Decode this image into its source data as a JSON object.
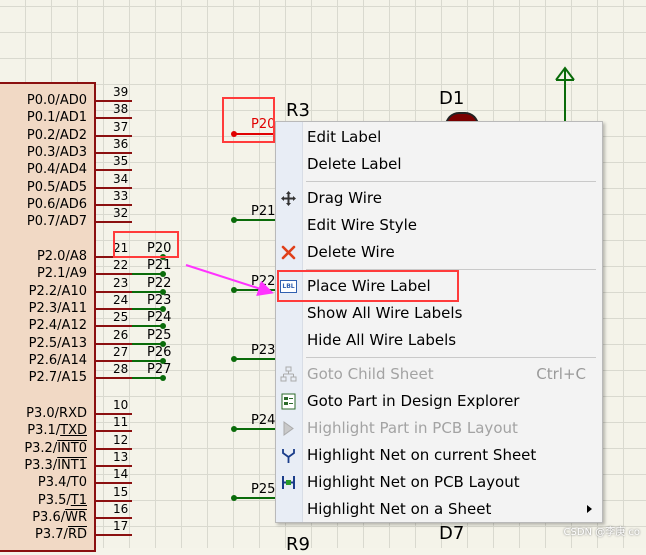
{
  "chip": {
    "left_pins": [
      {
        "label": "P0.0/AD0",
        "num": "39"
      },
      {
        "label": "P0.1/AD1",
        "num": "38"
      },
      {
        "label": "P0.2/AD2",
        "num": "37"
      },
      {
        "label": "P0.3/AD3",
        "num": "36"
      },
      {
        "label": "P0.4/AD4",
        "num": "35"
      },
      {
        "label": "P0.5/AD5",
        "num": "34"
      },
      {
        "label": "P0.6/AD6",
        "num": "33"
      },
      {
        "label": "P0.7/AD7",
        "num": "32"
      },
      {
        "label": "P2.0/A8",
        "num": "21"
      },
      {
        "label": "P2.1/A9",
        "num": "22"
      },
      {
        "label": "P2.2/A10",
        "num": "23"
      },
      {
        "label": "P2.3/A11",
        "num": "24"
      },
      {
        "label": "P2.4/A12",
        "num": "25"
      },
      {
        "label": "P2.5/A13",
        "num": "26"
      },
      {
        "label": "P2.6/A14",
        "num": "27"
      },
      {
        "label": "P2.7/A15",
        "num": "28"
      },
      {
        "label": "P3.0/RXD",
        "num": "10"
      },
      {
        "label": "P3.1/TXD",
        "num": "11"
      },
      {
        "label": "P3.2/INT0",
        "num": "12"
      },
      {
        "label": "P3.3/INT1",
        "num": "13"
      },
      {
        "label": "P3.4/T0",
        "num": "14"
      },
      {
        "label": "P3.5/T1",
        "num": "15"
      },
      {
        "label": "P3.6/WR",
        "num": "16"
      },
      {
        "label": "P3.7/RD",
        "num": "17"
      }
    ],
    "wire_labels": [
      "P20",
      "P21",
      "P22",
      "P23",
      "P24",
      "P25",
      "P26",
      "P27"
    ]
  },
  "schematic": {
    "net_labels": {
      "p20": "P20",
      "p21": "P21",
      "p22": "P22",
      "p23": "P23",
      "p24": "P24",
      "p25": "P25"
    },
    "components": {
      "r3": "R3",
      "d1": "D1",
      "d7": "D7",
      "r9": "R9"
    }
  },
  "context_menu": {
    "items": [
      {
        "label": "Edit Label",
        "icon": "none",
        "enabled": true
      },
      {
        "label": "Delete Label",
        "icon": "none",
        "enabled": true
      },
      {
        "label": "Drag Wire",
        "icon": "move-icon",
        "enabled": true
      },
      {
        "label": "Edit Wire Style",
        "icon": "none",
        "enabled": true
      },
      {
        "label": "Delete Wire",
        "icon": "delete-icon",
        "enabled": true
      },
      {
        "label": "Place Wire Label",
        "icon": "label-icon",
        "icon_text": "LBL",
        "enabled": true
      },
      {
        "label": "Show All Wire Labels",
        "icon": "none",
        "enabled": true
      },
      {
        "label": "Hide All Wire Labels",
        "icon": "none",
        "enabled": true
      },
      {
        "label": "Goto Child Sheet",
        "icon": "hierarchy-icon",
        "enabled": false,
        "shortcut": "Ctrl+C"
      },
      {
        "label": "Goto Part in Design Explorer",
        "icon": "explorer-icon",
        "enabled": true
      },
      {
        "label": "Highlight Part in PCB Layout",
        "icon": "pcb-arrow-icon",
        "enabled": false
      },
      {
        "label": "Highlight Net on current Sheet",
        "icon": "net-icon",
        "enabled": true
      },
      {
        "label": "Highlight Net on PCB Layout",
        "icon": "pcb-net-icon",
        "enabled": true
      },
      {
        "label": "Highlight Net on a Sheet",
        "icon": "none",
        "enabled": true,
        "submenu": true
      }
    ]
  },
  "watermark": "CSDN @李庚 co",
  "colors": {
    "wire": "#0a6b0a",
    "highlight": "#ff3b3b",
    "arrow": "#ff33ff",
    "chip_border": "#8b1010",
    "chip_fill": "#f1d9c5"
  }
}
